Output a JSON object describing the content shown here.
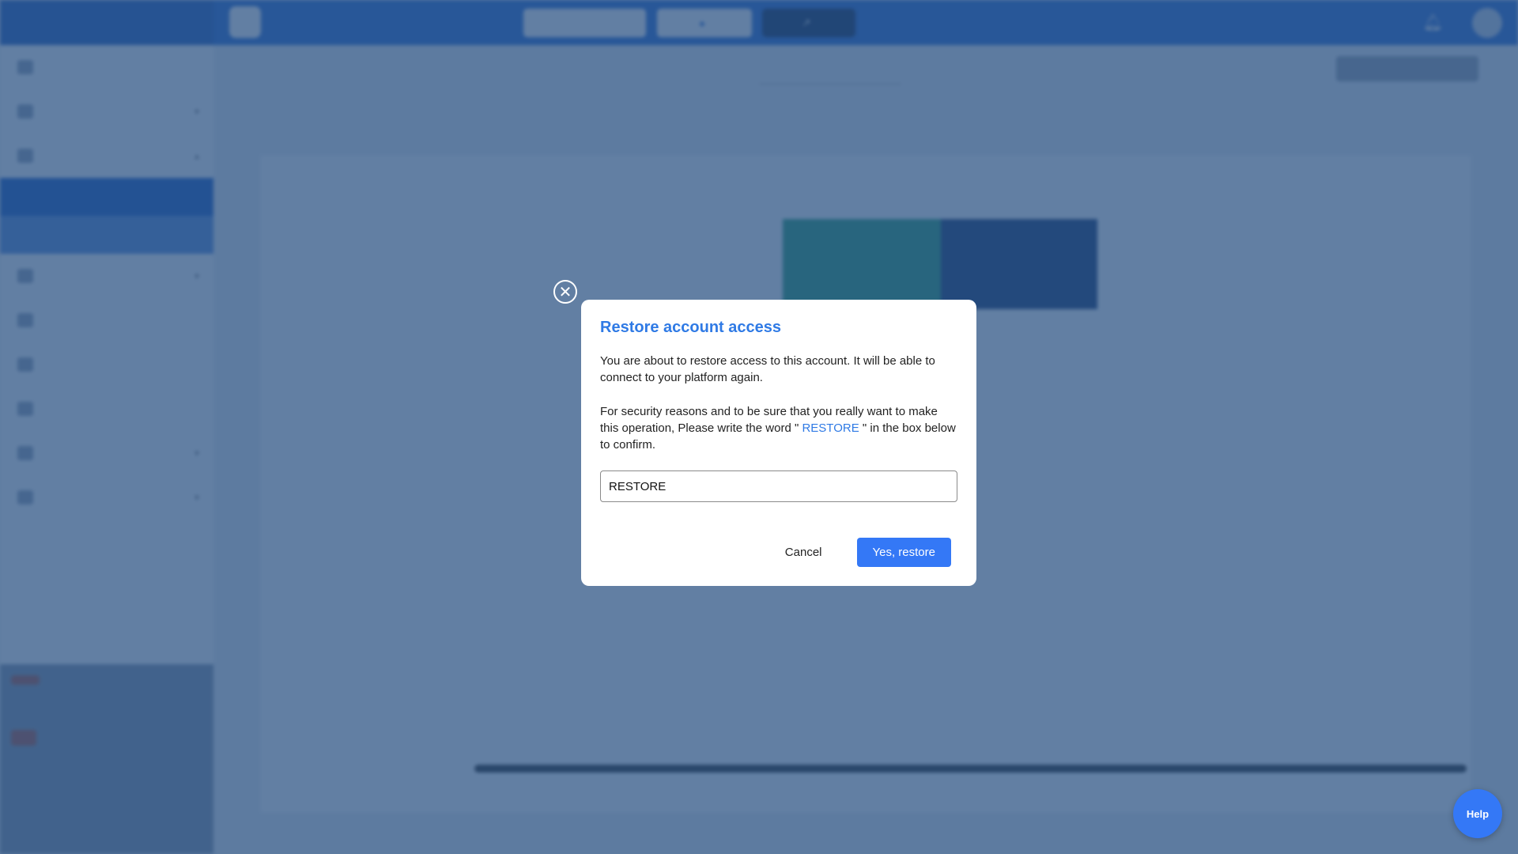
{
  "app": {
    "brand": "",
    "org_logo_text": "",
    "org_name": "",
    "org_subtitle": "",
    "top_buttons": [
      {
        "label": ""
      },
      {
        "label": ""
      },
      {
        "label": ""
      }
    ],
    "language": "",
    "avatar_icon": "user-avatar"
  },
  "sidebar": {
    "items_before": [
      {
        "label": "",
        "icon": "dashboard-icon",
        "has_chevron": false
      },
      {
        "label": "",
        "icon": "programs-icon",
        "has_chevron": true
      },
      {
        "label": "",
        "icon": "accounts-icon",
        "has_chevron": true
      }
    ],
    "sub_items": [
      {
        "label": "",
        "state": "active"
      },
      {
        "label": "",
        "state": "highlight"
      }
    ],
    "items_after": [
      {
        "label": "",
        "icon": "settings-icon",
        "has_chevron": true
      },
      {
        "label": "",
        "icon": "link-icon",
        "has_chevron": false
      },
      {
        "label": "",
        "icon": "link-icon",
        "has_chevron": false
      },
      {
        "label": "",
        "icon": "stats-icon",
        "has_chevron": false
      },
      {
        "label": "",
        "icon": "calendar-icon",
        "has_chevron": true
      },
      {
        "label": "",
        "icon": "tools-icon",
        "has_chevron": true
      }
    ],
    "promo": {
      "tag": "",
      "text": "",
      "button": ""
    }
  },
  "content": {
    "title": "",
    "search_placeholder": "",
    "filters_label": "",
    "top_right_button": "",
    "tabs": [
      {
        "label": "",
        "active": false
      },
      {
        "label": "",
        "active": false
      },
      {
        "label": "",
        "active": true
      }
    ],
    "table": {
      "count_label": "",
      "pagination": "",
      "columns": [
        "",
        "",
        "",
        "",
        "",
        "",
        "",
        ""
      ],
      "rows": [
        [
          "",
          "",
          "",
          "",
          "",
          "",
          "",
          ""
        ],
        [
          "",
          "",
          "",
          "",
          "",
          "",
          "",
          ""
        ],
        [
          "",
          "",
          "",
          "",
          "",
          "",
          "",
          ""
        ]
      ]
    }
  },
  "modal": {
    "title": "Restore account access",
    "paragraph1": "You are about to restore access to this account. It will be able to connect to your platform again.",
    "paragraph2_before": "For security reasons and to be sure that you really want to make this operation, Please write the word \"",
    "keyword": " RESTORE ",
    "paragraph2_after": "\" in the box below to confirm.",
    "input_value": "RESTORE",
    "cancel_label": "Cancel",
    "confirm_label": "Yes, restore",
    "accent_color": "#2f7ae5",
    "button_color": "#3478f6"
  },
  "help": {
    "label": "Help"
  }
}
